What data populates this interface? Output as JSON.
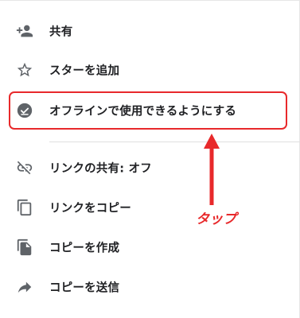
{
  "menu": {
    "items": [
      {
        "label": "共有",
        "icon": "add-person-icon"
      },
      {
        "label": "スターを追加",
        "icon": "star-outline-icon"
      },
      {
        "label": "オフラインで使用できるようにする",
        "icon": "offline-check-icon"
      },
      {
        "label": "リンクの共有: オフ",
        "icon": "link-off-icon"
      },
      {
        "label": "リンクをコピー",
        "icon": "copy-icon"
      },
      {
        "label": "コピーを作成",
        "icon": "file-copy-icon"
      },
      {
        "label": "コピーを送信",
        "icon": "share-arrow-icon"
      }
    ]
  },
  "annotation": {
    "tap_label": "タップ",
    "color": "#e8292b"
  },
  "colors": {
    "icon": "#5f6368",
    "text": "#202124",
    "accent": "#e8292b"
  }
}
